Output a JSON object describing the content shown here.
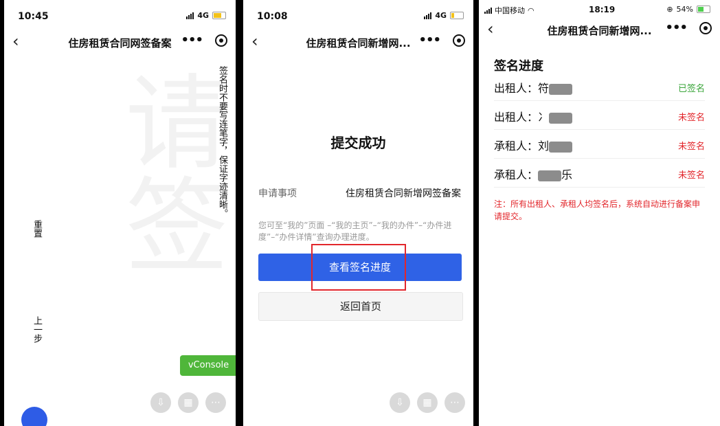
{
  "panel1": {
    "status": {
      "time": "10:45",
      "network": "4G"
    },
    "nav": {
      "back": "‹",
      "title": "住房租赁合同网签备案",
      "more": "•••"
    },
    "instruction": "签名时不要写连笔字，保证字迹清晰。",
    "reset_label": "重置",
    "prev_label": "上一步",
    "vconsole_label": "vConsole",
    "background_glyphs": "请签",
    "icons": [
      "download-icon",
      "grid-icon",
      "more-icon"
    ]
  },
  "panel2": {
    "status": {
      "time": "10:08",
      "network": "4G"
    },
    "nav": {
      "back": "‹",
      "title": "住房租赁合同新增网...",
      "more": "•••"
    },
    "success_text": "提交成功",
    "item_label": "申请事项",
    "item_value": "住房租赁合同新增网签备案",
    "hint": "您可至“我的”页面 –“我的主页”–“我的办件”–“办件进度”–“办件详情”查询办理进度。",
    "primary_button": "查看签名进度",
    "secondary_button": "返回首页",
    "highlight_color": "#e2262b"
  },
  "panel3": {
    "status": {
      "carrier": "中国移动",
      "time": "18:19",
      "battery": "54%"
    },
    "nav": {
      "back": "‹",
      "title": "住房租赁合同新增网...",
      "more": "•••"
    },
    "section_title": "签名进度",
    "signers": [
      {
        "role": "出租人：",
        "name_visible": "符",
        "name_tail": "",
        "status": "已签名",
        "status_color": "#3aa53a"
      },
      {
        "role": "出租人：",
        "name_visible": "冫",
        "name_tail": "",
        "status": "未签名",
        "status_color": "#e2262b"
      },
      {
        "role": "承租人：",
        "name_visible": "刘",
        "name_tail": "",
        "status": "未签名",
        "status_color": "#e2262b"
      },
      {
        "role": "承租人：",
        "name_visible": "",
        "name_tail": "乐",
        "status": "未签名",
        "status_color": "#e2262b"
      }
    ],
    "note": "注：所有出租人、承租人均签名后，系统自动进行备案申请提交。"
  }
}
